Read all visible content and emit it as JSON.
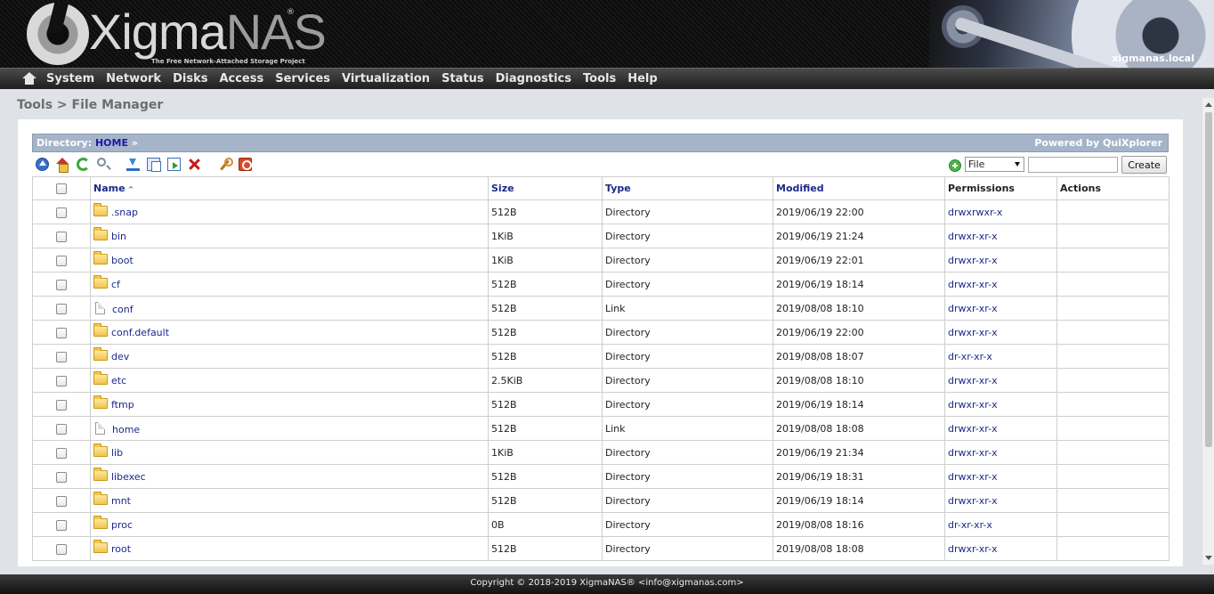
{
  "header": {
    "logo_main": "Xigma",
    "logo_accent": "NAS",
    "logo_reg": "®",
    "logo_tagline": "The Free Network-Attached Storage Project",
    "hostname": "xigmanas.local"
  },
  "nav": {
    "items": [
      "System",
      "Network",
      "Disks",
      "Access",
      "Services",
      "Virtualization",
      "Status",
      "Diagnostics",
      "Tools",
      "Help"
    ]
  },
  "breadcrumb": "Tools > File Manager",
  "directory": {
    "label": "Directory:",
    "home": "HOME",
    "separator": "»",
    "powered_by": "Powered by QuiXplorer"
  },
  "create": {
    "type_value": "File",
    "name_value": "",
    "button_label": "Create"
  },
  "table": {
    "headers": {
      "name": "Name",
      "sort_indicator": "^",
      "size": "Size",
      "type": "Type",
      "modified": "Modified",
      "permissions": "Permissions",
      "actions": "Actions"
    },
    "rows": [
      {
        "name": ".snap",
        "kind": "folder",
        "size": "512B",
        "type": "Directory",
        "modified": "2019/06/19 22:00",
        "perm": "drwxrwxr-x"
      },
      {
        "name": "bin",
        "kind": "folder",
        "size": "1KiB",
        "type": "Directory",
        "modified": "2019/06/19 21:24",
        "perm": "drwxr-xr-x"
      },
      {
        "name": "boot",
        "kind": "folder",
        "size": "1KiB",
        "type": "Directory",
        "modified": "2019/06/19 22:01",
        "perm": "drwxr-xr-x"
      },
      {
        "name": "cf",
        "kind": "folder",
        "size": "512B",
        "type": "Directory",
        "modified": "2019/06/19 18:14",
        "perm": "drwxr-xr-x"
      },
      {
        "name": "conf",
        "kind": "file",
        "size": "512B",
        "type": "Link",
        "modified": "2019/08/08 18:10",
        "perm": "drwxr-xr-x"
      },
      {
        "name": "conf.default",
        "kind": "folder",
        "size": "512B",
        "type": "Directory",
        "modified": "2019/06/19 22:00",
        "perm": "drwxr-xr-x"
      },
      {
        "name": "dev",
        "kind": "folder",
        "size": "512B",
        "type": "Directory",
        "modified": "2019/08/08 18:07",
        "perm": "dr-xr-xr-x"
      },
      {
        "name": "etc",
        "kind": "folder",
        "size": "2.5KiB",
        "type": "Directory",
        "modified": "2019/08/08 18:10",
        "perm": "drwxr-xr-x"
      },
      {
        "name": "ftmp",
        "kind": "folder",
        "size": "512B",
        "type": "Directory",
        "modified": "2019/06/19 18:14",
        "perm": "drwxr-xr-x"
      },
      {
        "name": "home",
        "kind": "file",
        "size": "512B",
        "type": "Link",
        "modified": "2019/08/08 18:08",
        "perm": "drwxr-xr-x"
      },
      {
        "name": "lib",
        "kind": "folder",
        "size": "1KiB",
        "type": "Directory",
        "modified": "2019/06/19 21:34",
        "perm": "drwxr-xr-x"
      },
      {
        "name": "libexec",
        "kind": "folder",
        "size": "512B",
        "type": "Directory",
        "modified": "2019/06/19 18:31",
        "perm": "drwxr-xr-x"
      },
      {
        "name": "mnt",
        "kind": "folder",
        "size": "512B",
        "type": "Directory",
        "modified": "2019/06/19 18:14",
        "perm": "drwxr-xr-x"
      },
      {
        "name": "proc",
        "kind": "folder",
        "size": "0B",
        "type": "Directory",
        "modified": "2019/08/08 18:16",
        "perm": "dr-xr-xr-x"
      },
      {
        "name": "root",
        "kind": "folder",
        "size": "512B",
        "type": "Directory",
        "modified": "2019/08/08 18:08",
        "perm": "drwxr-xr-x"
      }
    ]
  },
  "footer": "Copyright © 2018-2019 XigmaNAS® <info@xigmanas.com>"
}
